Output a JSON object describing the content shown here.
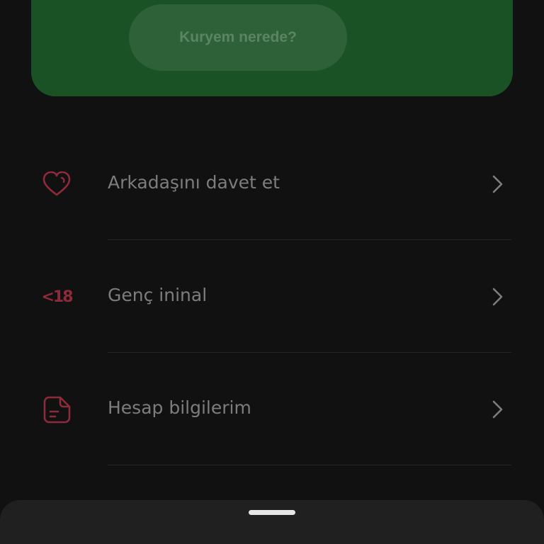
{
  "header": {
    "courier_button_label": "Kuryem nerede?"
  },
  "menu": {
    "items": [
      {
        "icon": "heart-icon",
        "label": "Arkadaşını davet et"
      },
      {
        "icon": "under-18-icon",
        "icon_text": "<18",
        "label": "Genç ininal"
      },
      {
        "icon": "document-icon",
        "label": "Hesap bilgilerim"
      }
    ]
  },
  "colors": {
    "background": "#111111",
    "green_card": "#1a5226",
    "icon_accent": "#8e2a3a",
    "label_text": "#7d7d7d"
  }
}
